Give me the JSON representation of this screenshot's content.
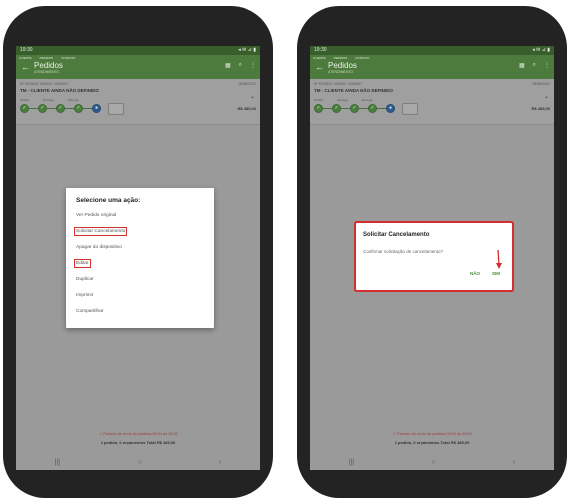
{
  "status_bar": {
    "time_left": "19:30",
    "time_right": "19:30",
    "icons_right": "◂ ✉ ⊿ ▮"
  },
  "app_bar": {
    "title": "Pedidos",
    "subtitle": "ATENDIMENTO",
    "tabs": [
      "CLIENTE",
      "PEDIDOS",
      "CONTATO"
    ]
  },
  "order": {
    "meta": "Nº PEDIDO: 000000 / 0000047",
    "date": "05/08/2021",
    "client": "TM - CLIENTE AINDA NÃO DEFINIDO",
    "stage_labels": [
      "Pedido",
      "Entrega",
      "Entrega"
    ],
    "total": "R$ 485,00"
  },
  "action_menu": {
    "title": "Selecione uma ação:",
    "items": [
      {
        "label": "Ver Pedido original",
        "highlight": false
      },
      {
        "label": "Solicitar Cancelamento",
        "highlight": true
      },
      {
        "label": "Apagar do dispositivo",
        "highlight": false
      },
      {
        "label": "Editar",
        "highlight": true
      },
      {
        "label": "Duplicar",
        "highlight": false
      },
      {
        "label": "Imprimir",
        "highlight": false
      },
      {
        "label": "Compartilhar",
        "highlight": false
      }
    ]
  },
  "dialog": {
    "title": "Solicitar Cancelamento",
    "message": "Confirmar solicitação de cancelamento?",
    "no_label": "NÃO",
    "yes_label": "SIM"
  },
  "footer": {
    "warning": "ⓘ Período de envio de pedidos 09:01 às 23:00",
    "summary": "1 pedido, 0 orçamentos   Total R$ 485,00"
  },
  "nav": {
    "recents": "|||",
    "home": "○",
    "back": "‹"
  },
  "colors": {
    "brand_green": "#4d7a3d",
    "highlight_red": "#d32f2f",
    "action_green": "#4d8a3a"
  }
}
